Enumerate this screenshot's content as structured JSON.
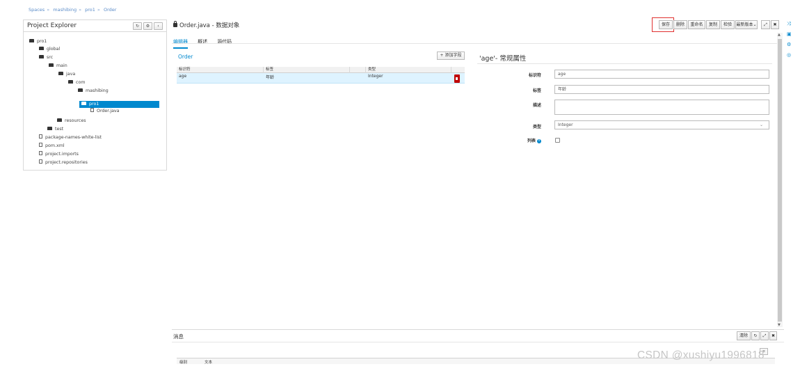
{
  "breadcrumb": [
    "Spaces",
    "mashibing",
    "pro1",
    "Order"
  ],
  "breadcrumb_separator": "»",
  "project_explorer": {
    "title": "Project Explorer",
    "toolbar": [
      "↻",
      "⚙",
      "‹"
    ],
    "tree": [
      {
        "label": "pro1",
        "type": "folder"
      },
      {
        "label": "global",
        "type": "folder"
      },
      {
        "label": "src",
        "type": "folder"
      },
      {
        "label": "main",
        "type": "folder"
      },
      {
        "label": "java",
        "type": "folder"
      },
      {
        "label": "com",
        "type": "folder"
      },
      {
        "label": "mashibing",
        "type": "folder"
      },
      {
        "label": "pro1",
        "type": "folder",
        "selected": true
      },
      {
        "label": "Order.java",
        "type": "file"
      },
      {
        "label": "resources",
        "type": "folder"
      },
      {
        "label": "test",
        "type": "folder"
      },
      {
        "label": "package-names-white-list",
        "type": "file"
      },
      {
        "label": "pom.xml",
        "type": "file"
      },
      {
        "label": "project.imports",
        "type": "file"
      },
      {
        "label": "project.repositories",
        "type": "file"
      }
    ]
  },
  "editor": {
    "title": "Order.java - 数据对象",
    "tabs": [
      "编辑器",
      "概述",
      "源代码"
    ],
    "toolbar": {
      "save": "保存",
      "delete": "删除",
      "rename": "重命名",
      "copy": "复制",
      "validate": "检验",
      "latest_version": "最新版本",
      "latest_version_caret": "⌄",
      "maximize": "⤢",
      "close": "✖"
    },
    "object_name": "Order",
    "add_field": "+ 添加字段",
    "table": {
      "headers": [
        "标识符",
        "标签",
        "类型"
      ],
      "rows": [
        [
          "age",
          "年龄",
          "Integer"
        ]
      ]
    },
    "properties": {
      "title": "'age'- 常规属性",
      "identifier_label": "标识符",
      "identifier_value": "age",
      "label_label": "标签",
      "label_value": "年龄",
      "description_label": "描述",
      "description_value": "",
      "type_label": "类型",
      "type_value": "Integer",
      "type_caret": "⌄",
      "list_label": "列表",
      "info_glyph": "i",
      "list_checked": false
    }
  },
  "scrollbar": {
    "up": "▲",
    "down": "▼"
  },
  "side_icons": [
    "⤨",
    "▣",
    "⚙",
    "◎"
  ],
  "messages": {
    "title": "消息",
    "clear": "清除",
    "refresh": "↻",
    "maximize": "⤢",
    "close": "✖",
    "filter": "≡",
    "columns": [
      "级别",
      "文本"
    ]
  },
  "watermark": "CSDN @xushiyu1996818"
}
